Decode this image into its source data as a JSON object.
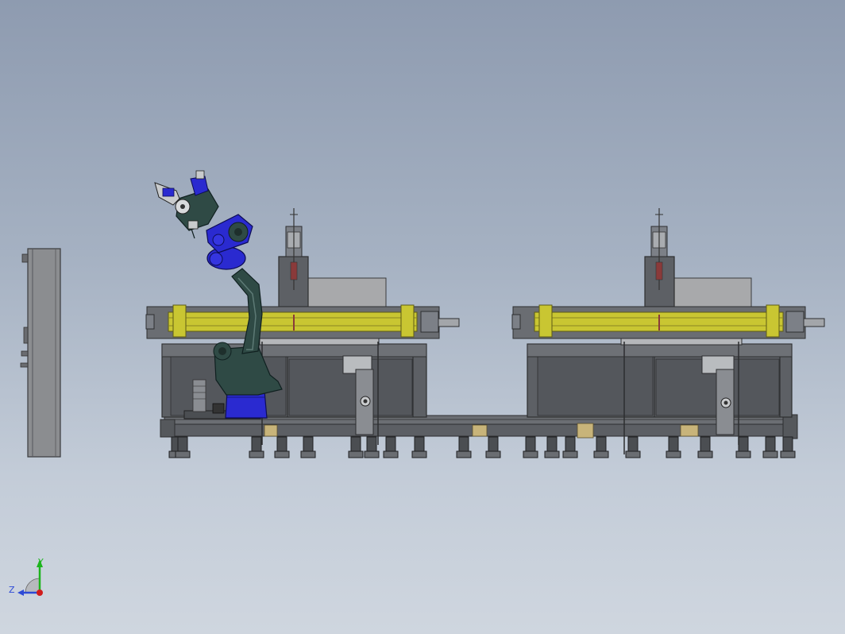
{
  "viewport": {
    "background_top": "#8e9bb0",
    "background_bottom": "#cfd6df"
  },
  "triad": {
    "y_label": "Y",
    "z_label": "Z",
    "y_color": "#1db41d",
    "z_color": "#2d4ad6",
    "x_color": "#d01c1c"
  },
  "colors": {
    "frame": "#595c61",
    "frame_light": "#7c8087",
    "beam_yellow": "#c9c632",
    "beam_yellow_dark": "#8a8722",
    "robot_blue": "#2a2ad0",
    "robot_teal": "#2f4a45",
    "cabinet": "#8b8d90",
    "brass": "#c8b47a"
  }
}
